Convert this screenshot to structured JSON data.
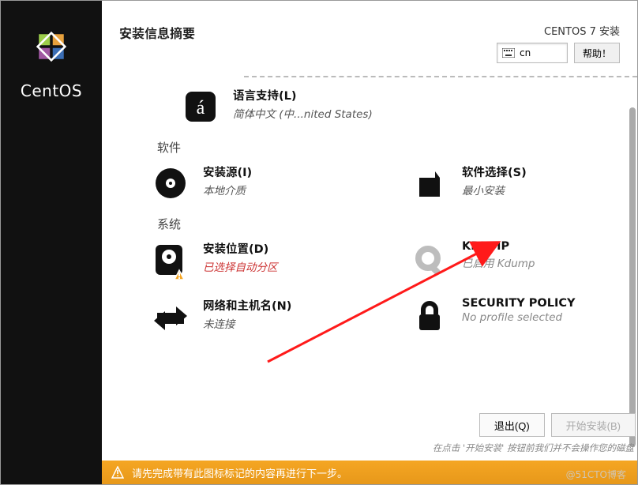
{
  "header": {
    "title": "安装信息摘要",
    "product": "CENTOS 7 安装",
    "keyboard_label": "cn",
    "help_label": "帮助！"
  },
  "sidebar": {
    "brand": "CentOS"
  },
  "localization": {
    "language": {
      "title": "语言支持(L)",
      "status": "简体中文 (中...nited States)"
    }
  },
  "sections": {
    "software": {
      "label": "软件"
    },
    "system": {
      "label": "系统"
    }
  },
  "software": {
    "source": {
      "title": "安装源(I)",
      "status": "本地介质"
    },
    "selection": {
      "title": "软件选择(S)",
      "status": "最小安装"
    }
  },
  "system": {
    "destination": {
      "title": "安装位置(D)",
      "status": "已选择自动分区"
    },
    "kdump": {
      "title": "KDUMP",
      "status": "已启用 Kdump"
    },
    "network": {
      "title": "网络和主机名(N)",
      "status": "未连接"
    },
    "security": {
      "title": "SECURITY POLICY",
      "status": "No profile selected"
    }
  },
  "footer": {
    "quit": "退出(Q)",
    "begin": "开始安装(B)",
    "hint": "在点击 '开始安装' 按钮前我们并不会操作您的磁盘"
  },
  "warning": {
    "text": "请先完成带有此图标标记的内容再进行下一步。"
  },
  "watermark": "@51CTO博客"
}
